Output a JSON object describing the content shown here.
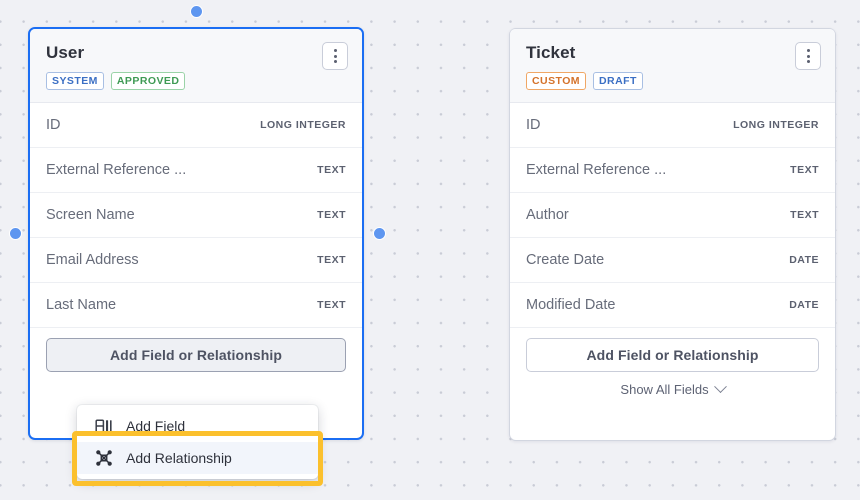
{
  "canvas": {
    "label": "entity-relationship-canvas"
  },
  "cards": [
    {
      "id": "user",
      "title": "User",
      "badges": [
        {
          "label": "SYSTEM",
          "color": "#3b6fc4"
        },
        {
          "label": "APPROVED",
          "color": "#3f9a54"
        }
      ],
      "menu_button": "⋮",
      "fields": [
        {
          "name": "ID",
          "type": "LONG INTEGER"
        },
        {
          "name": "External Reference ...",
          "type": "TEXT"
        },
        {
          "name": "Screen Name",
          "type": "TEXT"
        },
        {
          "name": "Email Address",
          "type": "TEXT"
        },
        {
          "name": "Last Name",
          "type": "TEXT"
        }
      ],
      "add_button": "Add Field or Relationship"
    },
    {
      "id": "ticket",
      "title": "Ticket",
      "badges": [
        {
          "label": "CUSTOM",
          "color": "#d4722a"
        },
        {
          "label": "DRAFT",
          "color": "#3b6fc4"
        }
      ],
      "menu_button": "⋮",
      "fields": [
        {
          "name": "ID",
          "type": "LONG INTEGER"
        },
        {
          "name": "External Reference ...",
          "type": "TEXT"
        },
        {
          "name": "Author",
          "type": "TEXT"
        },
        {
          "name": "Create Date",
          "type": "DATE"
        },
        {
          "name": "Modified Date",
          "type": "DATE"
        }
      ],
      "add_button": "Add Field or Relationship",
      "show_all_label": "Show All Fields"
    }
  ],
  "dropdown": {
    "items": [
      {
        "label": "Add Field",
        "icon": "table-column-icon",
        "hovered": false
      },
      {
        "label": "Add Relationship",
        "icon": "node-graph-icon",
        "hovered": true
      }
    ]
  },
  "highlight": {
    "color": "#fbc02d",
    "target": "Add Relationship"
  },
  "handles": [
    {
      "position": "top"
    },
    {
      "position": "left"
    },
    {
      "position": "right"
    }
  ]
}
